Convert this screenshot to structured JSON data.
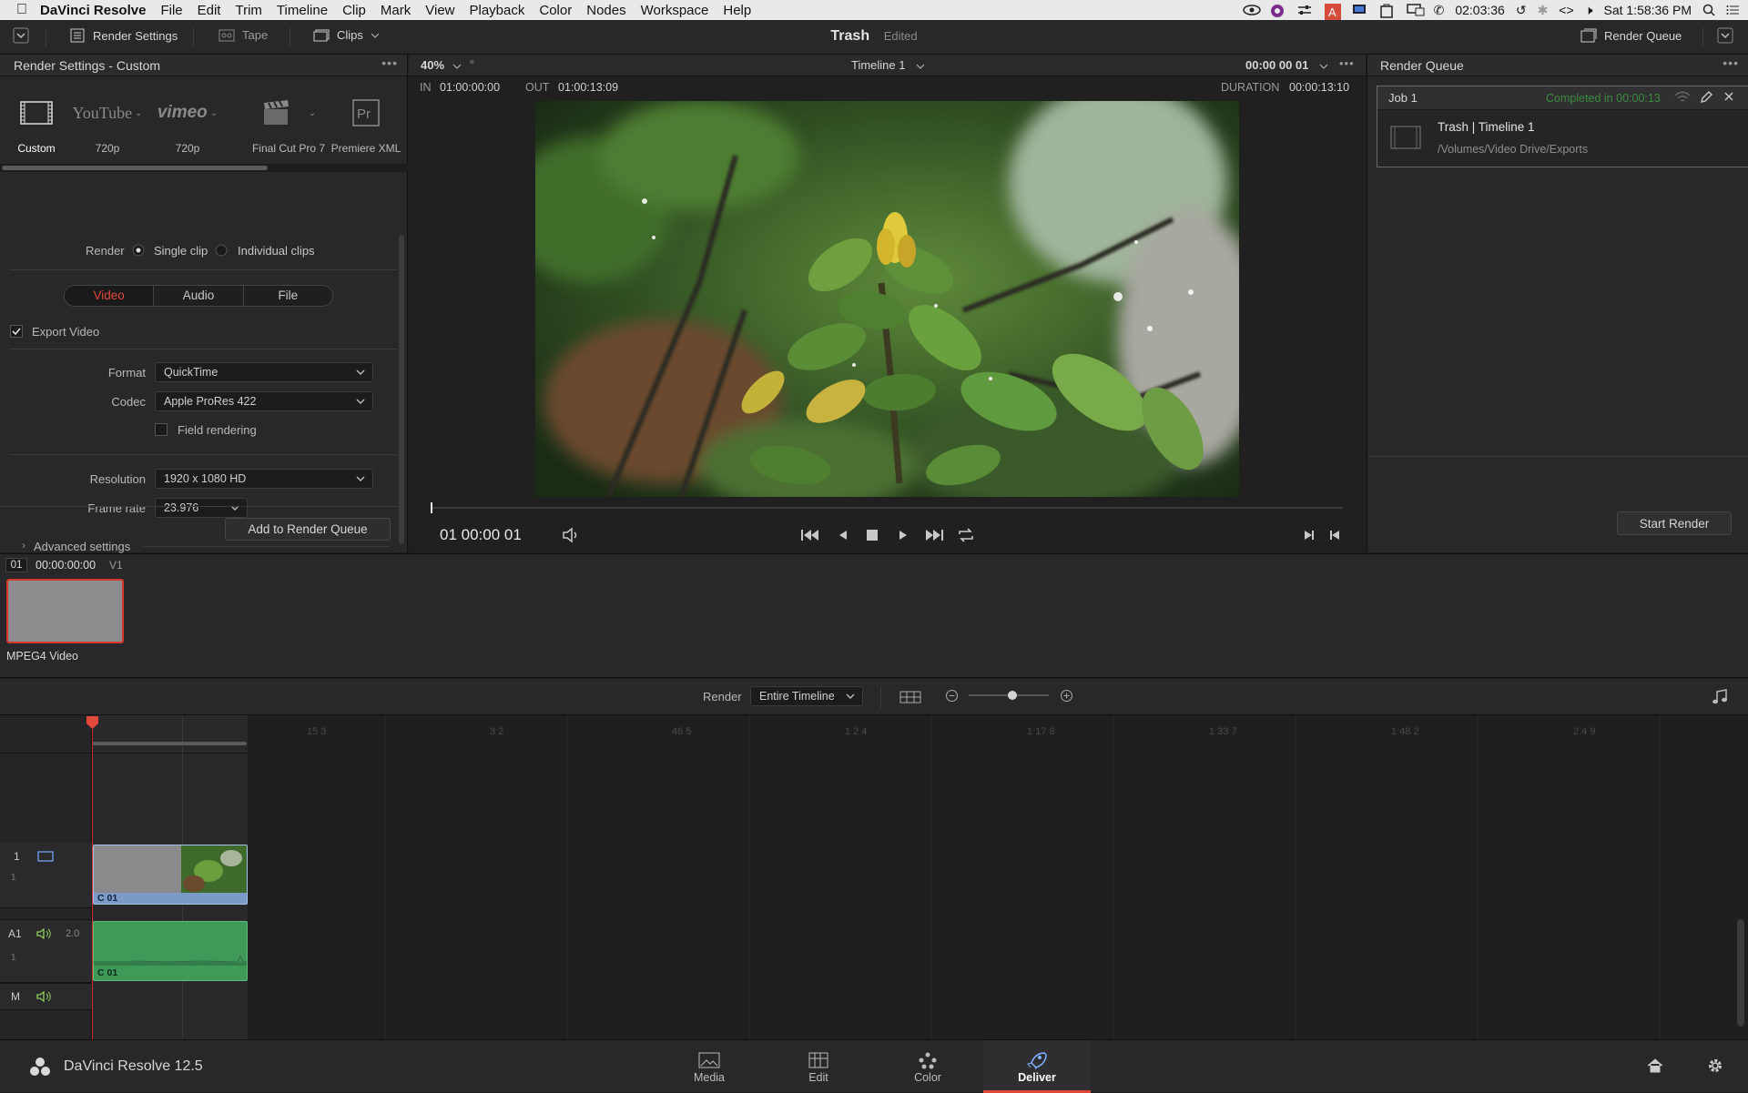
{
  "menubar": {
    "app_name": "DaVinci Resolve",
    "items": [
      "File",
      "Edit",
      "Trim",
      "Timeline",
      "Clip",
      "Mark",
      "View",
      "Playback",
      "Color",
      "Nodes",
      "Workspace",
      "Help"
    ],
    "timer": "02:03:36",
    "clock": "Sat 1:58:36 PM"
  },
  "toolbar": {
    "render_settings": "Render Settings",
    "tape": "Tape",
    "clips": "Clips",
    "project": "Trash",
    "status": "Edited",
    "render_queue": "Render Queue"
  },
  "render_settings": {
    "title": "Render Settings - Custom",
    "presets": [
      {
        "name": "Custom",
        "icon": "film-icon"
      },
      {
        "name": "720p",
        "icon": "youtube-logo"
      },
      {
        "name": "720p",
        "icon": "vimeo-logo"
      },
      {
        "name": "Final Cut Pro 7",
        "icon": "clapper-icon"
      },
      {
        "name": "Premiere XML",
        "icon": "premiere-icon"
      }
    ],
    "youtube_logo": "YouTube",
    "vimeo_logo": "vimeo",
    "premiere_logo": "Pr",
    "render_label": "Render",
    "single_clip": "Single clip",
    "individual_clips": "Individual clips",
    "tabs": [
      "Video",
      "Audio",
      "File"
    ],
    "active_tab": "Video",
    "export_video": "Export Video",
    "format_label": "Format",
    "format_value": "QuickTime",
    "codec_label": "Codec",
    "codec_value": "Apple ProRes 422",
    "field_rendering": "Field rendering",
    "resolution_label": "Resolution",
    "resolution_value": "1920 x 1080 HD",
    "framerate_label": "Frame rate",
    "framerate_value": "23.976",
    "advanced": "Advanced settings",
    "add_button": "Add to Render Queue",
    "accent": "#e2483a"
  },
  "viewer": {
    "zoom": "40%",
    "timeline_name": "Timeline 1",
    "timecode_top": "00:00 00 01",
    "in_label": "IN",
    "in_value": "01:00:00:00",
    "out_label": "OUT",
    "out_value": "01:00:13:09",
    "duration_label": "DURATION",
    "duration_value": "00:00:13:10",
    "timecode": "01 00:00 01"
  },
  "render_queue": {
    "title": "Render Queue",
    "job_title": "Job 1",
    "job_status": "Completed in 00:00:13",
    "job_name": "Trash | Timeline 1",
    "job_path": "/Volumes/Video Drive/Exports",
    "start_render": "Start Render",
    "status_color": "#3c8a3c"
  },
  "clips": {
    "index": "01",
    "timecode": "00:00:00:00",
    "track": "V1",
    "clip_name": "MPEG4 Video"
  },
  "timeline_bar": {
    "render_label": "Render",
    "render_value": "Entire Timeline",
    "zoom": 0.55
  },
  "timeline": {
    "ruler": [
      "15  3",
      "3    2",
      "46  5",
      "1  2  4",
      "1 17  8",
      "1 33  7",
      "1 48 2",
      "2  4  9"
    ],
    "video_track_num": "1",
    "video_track_sub": "1",
    "video_clip_label": "C  01",
    "audio_track_name": "A1",
    "audio_level": "2.0",
    "audio_track_sub": "1",
    "audio_clip_label": "C  01",
    "master_track": "M"
  },
  "pagebar": {
    "app_version": "DaVinci Resolve 12.5",
    "pages": [
      "Media",
      "Edit",
      "Color",
      "Deliver"
    ],
    "active": "Deliver"
  }
}
